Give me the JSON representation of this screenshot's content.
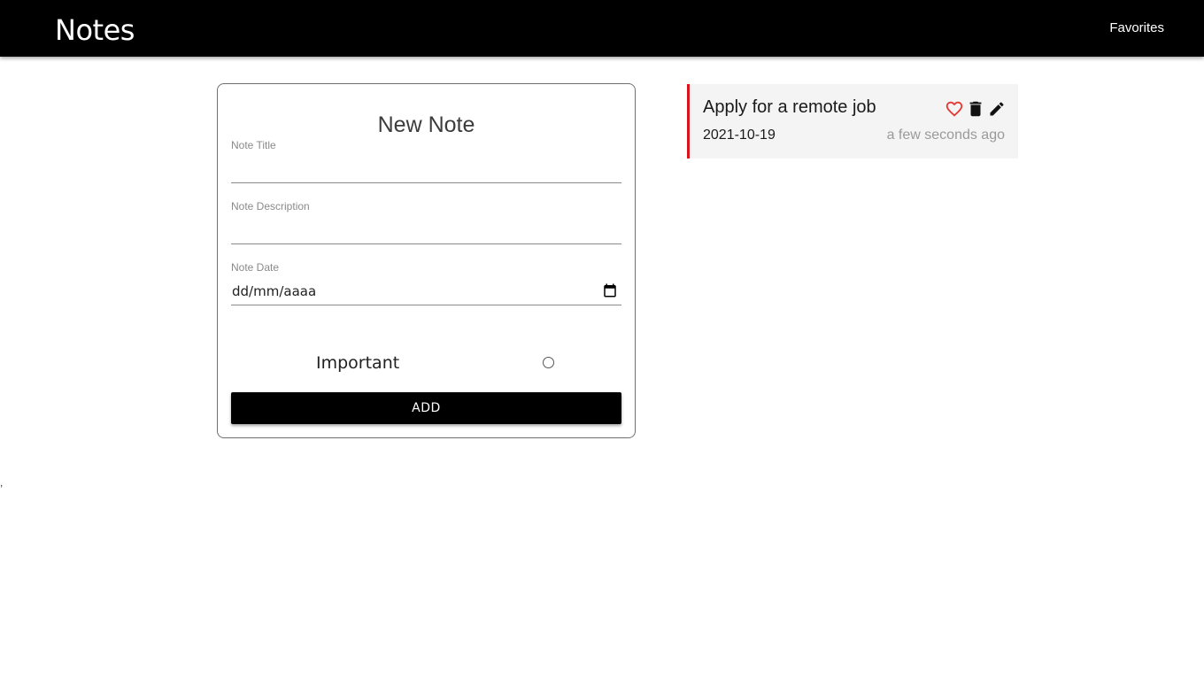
{
  "navbar": {
    "brand": "Notes",
    "favorites_link": "Favorites"
  },
  "form": {
    "title": "New Note",
    "note_title_label": "Note Title",
    "note_title_value": "",
    "note_description_label": "Note Description",
    "note_description_value": "",
    "note_date_label": "Note Date",
    "note_date_value": "dd/mm/aaaa",
    "important_label": "Important",
    "important_checked": false,
    "add_button": "ADD"
  },
  "notes": [
    {
      "title": "Apply for a remote job",
      "date": "2021-10-19",
      "relative_time": "a few seconds ago",
      "accent_color": "#d9141b",
      "icons": [
        "heart-outline-icon",
        "trash-icon",
        "pencil-icon"
      ]
    }
  ],
  "stray_text": ",",
  "colors": {
    "navbar": "#000000",
    "favorite_heart": "#e53935",
    "card_background": "#f4f4f4"
  }
}
